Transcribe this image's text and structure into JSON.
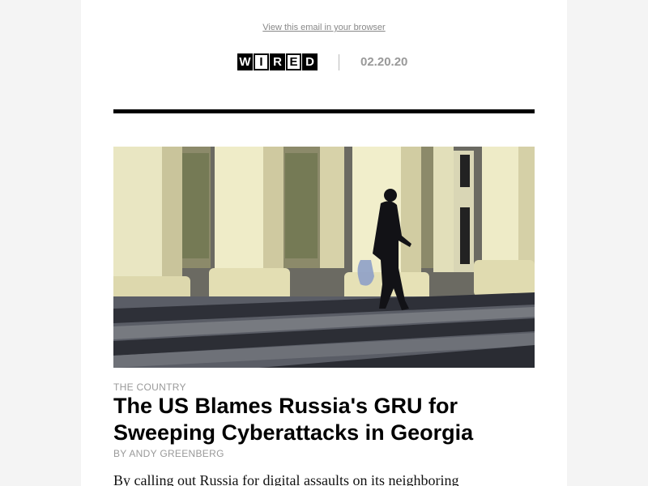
{
  "header": {
    "view_in_browser": "View this email in your browser",
    "logo_letters": [
      "W",
      "I",
      "R",
      "E",
      "D"
    ],
    "date": "02.20.20"
  },
  "article": {
    "kicker": "THE COUNTRY",
    "headline": "The US Blames Russia's GRU for Sweeping Cyberattacks in Georgia",
    "byline": "BY ANDY GREENBERG",
    "lede": "By calling out Russia for digital assaults on its neighboring"
  },
  "colors": {
    "page_bg": "#f4f4f4",
    "rule": "#000000",
    "meta_gray": "#999999"
  }
}
